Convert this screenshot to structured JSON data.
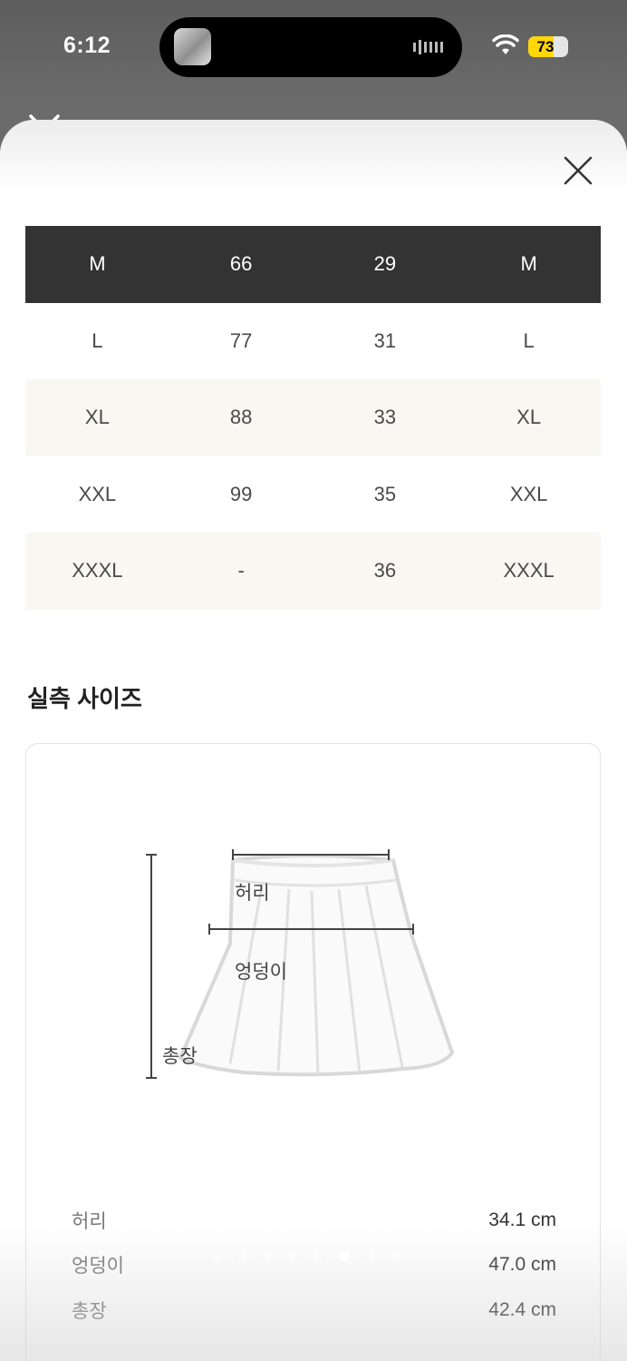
{
  "status_bar": {
    "time": "6:12",
    "battery": "73",
    "battery_level": 73
  },
  "size_table": {
    "rows": [
      [
        "M",
        "66",
        "29",
        "M"
      ],
      [
        "L",
        "77",
        "31",
        "L"
      ],
      [
        "XL",
        "88",
        "33",
        "XL"
      ],
      [
        "XXL",
        "99",
        "35",
        "XXL"
      ],
      [
        "XXXL",
        "-",
        "36",
        "XXXL"
      ]
    ]
  },
  "section": {
    "title": "실측 사이즈"
  },
  "diagram": {
    "label_waist": "허리",
    "label_hip": "엉덩이",
    "label_length": "총장"
  },
  "measurements": [
    {
      "name": "허리",
      "value": "34.1 cm"
    },
    {
      "name": "엉덩이",
      "value": "47.0 cm"
    },
    {
      "name": "총장",
      "value": "42.4 cm"
    }
  ],
  "pagination": {
    "count": 8,
    "active_index": 5
  },
  "icons": {
    "close": "close-icon",
    "wifi": "wifi-icon",
    "audio": "audio-wave-icon"
  },
  "colors": {
    "header_row": "#333333",
    "alt_row": "#f8f7f2",
    "battery": "#ffd60a"
  }
}
